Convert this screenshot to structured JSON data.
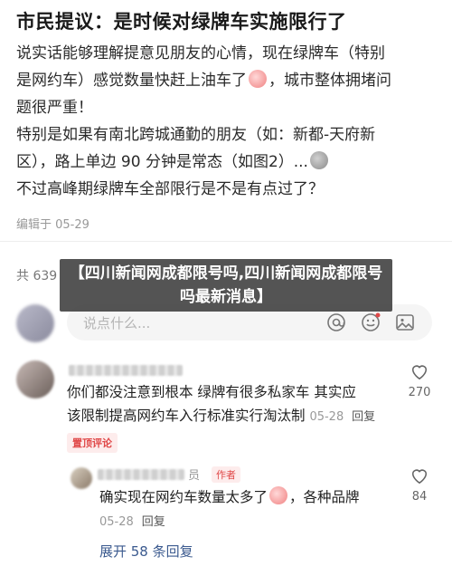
{
  "post": {
    "title": "市民提议：是时候对绿牌车实施限行了",
    "body_lines": [
      "说实话能够理解提意见朋友的心情，现在绿牌车（特别",
      "是网约车）感觉数量快赶上油车了",
      "，城市整体拥堵问",
      "题很严重！",
      "特别是如果有南北跨城通勤的朋友（如：新都-天府新",
      "区），路上单边 90 分钟是常态（如图2）...",
      "不过高峰期绿牌车全部限行是不是有点过了？"
    ],
    "edit_date": "编辑于 05-29"
  },
  "comments_header": {
    "count_text": "共 639"
  },
  "overlay": {
    "title": "【四川新闻网成都限号吗,四川新闻网成都限号吗最新消息】"
  },
  "input": {
    "placeholder": "说点什么..."
  },
  "comment1": {
    "line1": "你们都没注意到根本 绿牌有很多私家车 其实应",
    "line2": "该限制提高网约车入行标准实行淘汰制",
    "date": "05-28",
    "reply": "回复",
    "badge": "置顶评论",
    "likes": "270"
  },
  "reply1": {
    "name_tail": "员",
    "author_badge": "作者",
    "text_a": "确实现在网约车数量太多了",
    "text_b": "，各种品牌",
    "date": "05-28",
    "reply": "回复",
    "likes": "84"
  },
  "expand": {
    "label": "展开 58 条回复"
  },
  "colors": {
    "accent_red": "#e04848",
    "link_blue": "#3b5a8f",
    "overlay_bg": "#3c3c3c"
  }
}
